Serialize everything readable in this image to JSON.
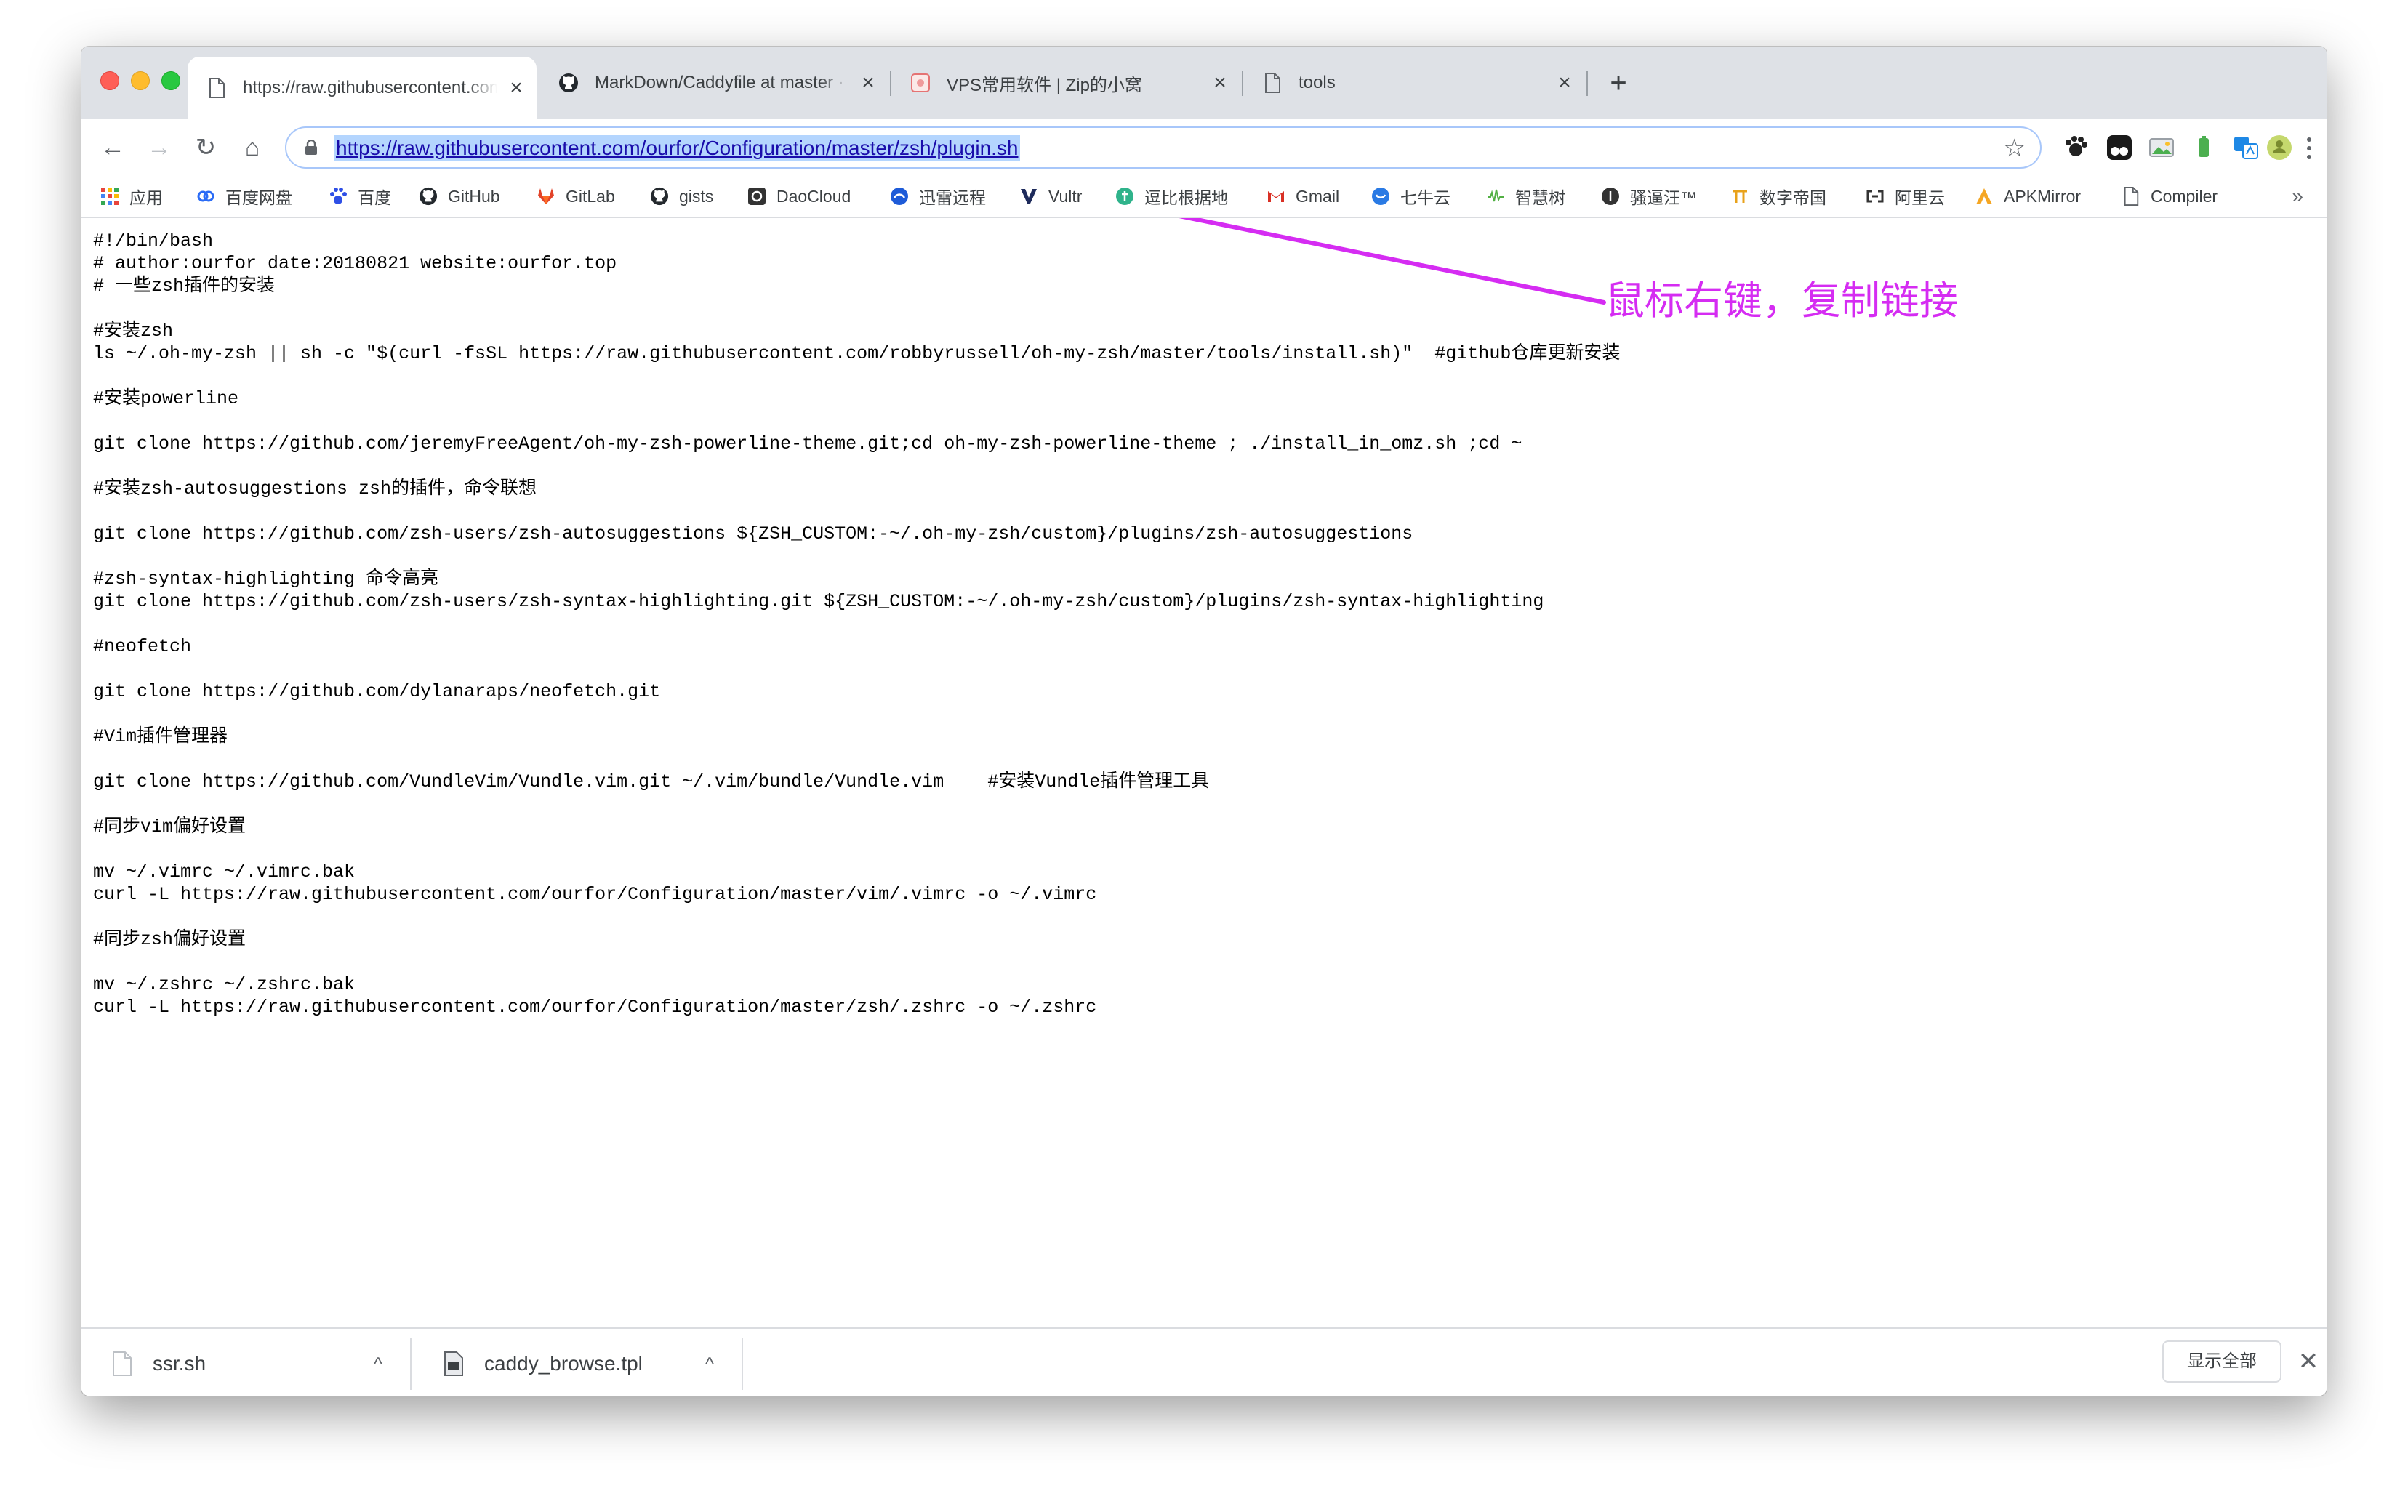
{
  "browser": {
    "tabs": [
      {
        "title": "https://raw.githubusercontent.com/ourfor/Configuration/master/zsh/plugin.sh",
        "favicon": "page-icon",
        "active": true
      },
      {
        "title": "MarkDown/Caddyfile at master · ourfor",
        "favicon": "github-icon",
        "active": false
      },
      {
        "title": "VPS常用软件 | Zip的小窝",
        "favicon": "site-icon",
        "active": false
      },
      {
        "title": "tools",
        "favicon": "page-icon",
        "active": false
      }
    ],
    "new_tab_symbol": "+",
    "tab_close_symbol": "×",
    "toolbar": {
      "back_symbol": "←",
      "forward_symbol": "→",
      "reload_symbol": "↻",
      "home_symbol": "⌂",
      "url": "https://raw.githubusercontent.com/ourfor/Configuration/master/zsh/plugin.sh",
      "star_symbol": "☆"
    },
    "bookmarks": [
      {
        "label": "应用",
        "icon": "apps-grid-icon",
        "color": "#e8453c"
      },
      {
        "label": "百度网盘",
        "icon": "baidu-pan-icon",
        "color": "#2b6cf6"
      },
      {
        "label": "百度",
        "icon": "baidu-paw-icon",
        "color": "#2e4fe6"
      },
      {
        "label": "GitHub",
        "icon": "github-icon",
        "color": "#24292e"
      },
      {
        "label": "GitLab",
        "icon": "gitlab-icon",
        "color": "#e24329"
      },
      {
        "label": "gists",
        "icon": "github-icon",
        "color": "#24292e"
      },
      {
        "label": "DaoCloud",
        "icon": "daocloud-icon",
        "color": "#333333"
      },
      {
        "label": "迅雷远程",
        "icon": "xunlei-icon",
        "color": "#1e5bd8"
      },
      {
        "label": "Vultr",
        "icon": "vultr-icon",
        "color": "#1e2b5b"
      },
      {
        "label": "逗比根据地",
        "icon": "doubi-icon",
        "color": "#2fb38b"
      },
      {
        "label": "Gmail",
        "icon": "gmail-icon",
        "color": "#d93025"
      },
      {
        "label": "七牛云",
        "icon": "qiniu-icon",
        "color": "#2a7ae4"
      },
      {
        "label": "智慧树",
        "icon": "zhihuishu-icon",
        "color": "#52b043"
      },
      {
        "label": "骚逼汪™",
        "icon": "dark-circle-icon",
        "color": "#333333"
      },
      {
        "label": "数字帝国",
        "icon": "pi-icon",
        "color": "#e8a21b"
      },
      {
        "label": "阿里云",
        "icon": "aliyun-icon",
        "color": "#333333"
      },
      {
        "label": "APKMirror",
        "icon": "apkmirror-icon",
        "color": "#f5a623"
      },
      {
        "label": "Compiler",
        "icon": "page-icon",
        "color": "#5f6368"
      }
    ],
    "bookmarks_more_symbol": "»"
  },
  "content": {
    "lines": [
      "#!/bin/bash",
      "# author:ourfor date:20180821 website:ourfor.top",
      "# 一些zsh插件的安装",
      "",
      "#安装zsh",
      "ls ~/.oh-my-zsh || sh -c \"$(curl -fsSL https://raw.githubusercontent.com/robbyrussell/oh-my-zsh/master/tools/install.sh)\"  #github仓库更新安装",
      "",
      "#安装powerline",
      "",
      "git clone https://github.com/jeremyFreeAgent/oh-my-zsh-powerline-theme.git;cd oh-my-zsh-powerline-theme ; ./install_in_omz.sh ;cd ~",
      "",
      "#安装zsh-autosuggestions zsh的插件，命令联想",
      "",
      "git clone https://github.com/zsh-users/zsh-autosuggestions ${ZSH_CUSTOM:-~/.oh-my-zsh/custom}/plugins/zsh-autosuggestions",
      "",
      "#zsh-syntax-highlighting 命令高亮",
      "git clone https://github.com/zsh-users/zsh-syntax-highlighting.git ${ZSH_CUSTOM:-~/.oh-my-zsh/custom}/plugins/zsh-syntax-highlighting",
      "",
      "#neofetch",
      "",
      "git clone https://github.com/dylanaraps/neofetch.git",
      "",
      "#Vim插件管理器",
      "",
      "git clone https://github.com/VundleVim/Vundle.vim.git ~/.vim/bundle/Vundle.vim    #安装Vundle插件管理工具",
      "",
      "#同步vim偏好设置",
      "",
      "mv ~/.vimrc ~/.vimrc.bak",
      "curl -L https://raw.githubusercontent.com/ourfor/Configuration/master/vim/.vimrc -o ~/.vimrc",
      "",
      "#同步zsh偏好设置",
      "",
      "mv ~/.zshrc ~/.zshrc.bak",
      "curl -L https://raw.githubusercontent.com/ourfor/Configuration/master/zsh/.zshrc -o ~/.zshrc"
    ],
    "annotation": {
      "text": "鼠标右键，复制链接",
      "color": "#d52cf2"
    }
  },
  "downloads": {
    "items": [
      {
        "name": "ssr.sh",
        "icon": "file-icon"
      },
      {
        "name": "caddy_browse.tpl",
        "icon": "file-dark-icon"
      }
    ],
    "chevron_symbol": "^",
    "show_all_label": "显示全部",
    "close_symbol": "✕"
  },
  "colors": {
    "tab_strip_bg": "#dee1e6",
    "url_selection_bg": "#b4d5fe",
    "annotation": "#d52cf2"
  }
}
